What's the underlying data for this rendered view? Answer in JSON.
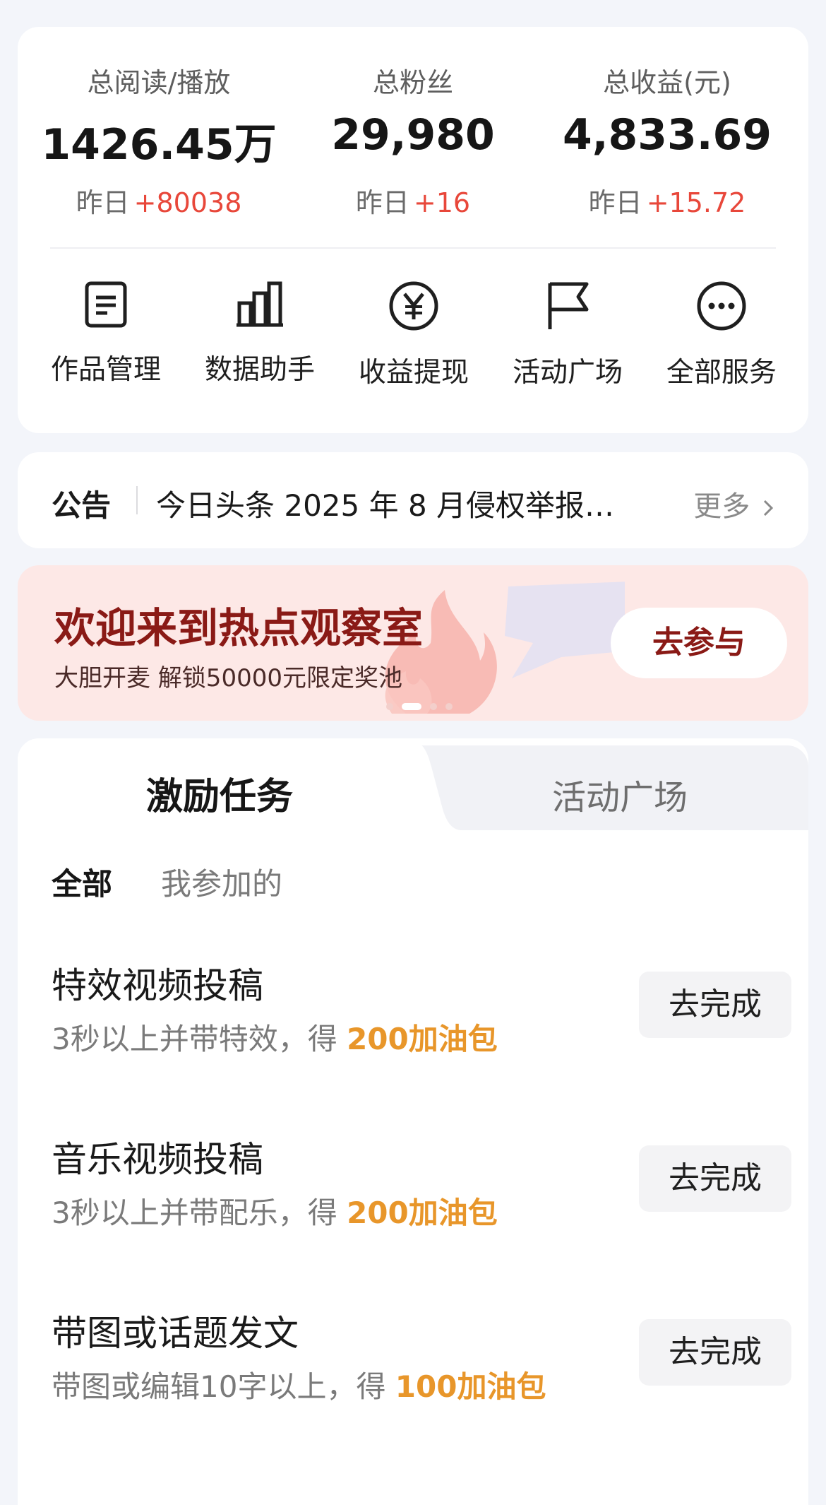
{
  "stats": [
    {
      "label": "总阅读/播放",
      "value": "1426.45万",
      "delta_prefix": "昨日",
      "delta": "+80038"
    },
    {
      "label": "总粉丝",
      "value": "29,980",
      "delta_prefix": "昨日",
      "delta": "+16"
    },
    {
      "label": "总收益(元)",
      "value": "4,833.69",
      "delta_prefix": "昨日",
      "delta": "+15.72"
    }
  ],
  "shortcuts": [
    {
      "label": "作品管理",
      "icon": "document-icon"
    },
    {
      "label": "数据助手",
      "icon": "bar-chart-icon"
    },
    {
      "label": "收益提现",
      "icon": "yuan-icon"
    },
    {
      "label": "活动广场",
      "icon": "flag-icon"
    },
    {
      "label": "全部服务",
      "icon": "more-icon"
    }
  ],
  "notice": {
    "title": "公告",
    "text": "今日头条 2025 年 8 月侵权举报…",
    "more": "更多"
  },
  "banner": {
    "title": "欢迎来到热点观察室",
    "subtitle": "大胆开麦 解锁50000元限定奖池",
    "button": "去参与",
    "active_slide": 2,
    "slide_count": 4
  },
  "tabs": {
    "active": "激励任务",
    "inactive": "活动广场"
  },
  "subtabs": {
    "active": "全部",
    "inactive": "我参加的"
  },
  "tasks": [
    {
      "title": "特效视频投稿",
      "desc": "3秒以上并带特效，得 ",
      "reward": "200加油包",
      "button": "去完成"
    },
    {
      "title": "音乐视频投稿",
      "desc": "3秒以上并带配乐，得 ",
      "reward": "200加油包",
      "button": "去完成"
    },
    {
      "title": "带图或话题发文",
      "desc": "带图或编辑10字以上，得 ",
      "reward": "100加油包",
      "button": "去完成"
    }
  ],
  "colors": {
    "accent_red": "#e8473a",
    "reward_orange": "#e8962a",
    "banner_title": "#8a1a16",
    "page_bg": "#f3f5fa"
  }
}
